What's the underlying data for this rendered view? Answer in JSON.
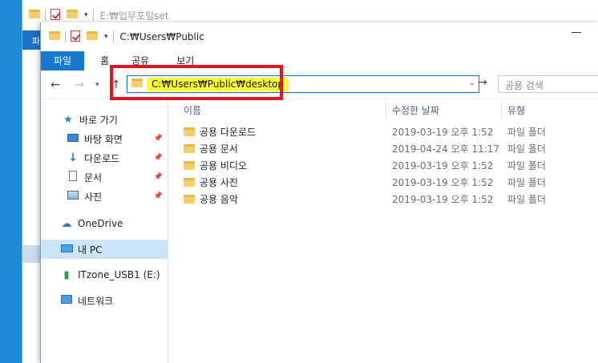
{
  "bg_window": {
    "title": "E:₩업무포털set",
    "ribbon_tab": "파"
  },
  "window": {
    "title": "C:₩Users₩Public",
    "tabs": [
      "파일",
      "홈",
      "공유",
      "보기"
    ]
  },
  "address_bar": {
    "value": "C:₩Users₩Public₩desktop",
    "dropdown_icon": "chevron-down",
    "highlight_color": "#ffff33",
    "callout_color": "#e2141f"
  },
  "search": {
    "placeholder": "공용 검색"
  },
  "nav_pane": {
    "quick_access": "바로 가기",
    "pinned": [
      "바탕 화면",
      "다운로드",
      "문서",
      "사진"
    ],
    "onedrive": "OneDrive",
    "this_pc": "내 PC",
    "usb": "ITzone_USB1 (E:)",
    "network": "네트워크"
  },
  "columns": {
    "name": "이름",
    "modified": "수정한 날짜",
    "type": "유형"
  },
  "files": [
    {
      "name": "공용 다운로드",
      "modified": "2019-03-19 오후 1:52",
      "type": "파일 폴더"
    },
    {
      "name": "공용 문서",
      "modified": "2019-04-24 오후 11:17",
      "type": "파일 폴더"
    },
    {
      "name": "공용 비디오",
      "modified": "2019-03-19 오후 1:52",
      "type": "파일 폴더"
    },
    {
      "name": "공용 사진",
      "modified": "2019-03-19 오후 1:52",
      "type": "파일 폴더"
    },
    {
      "name": "공용 음악",
      "modified": "2019-03-19 오후 1:52",
      "type": "파일 폴더"
    }
  ]
}
